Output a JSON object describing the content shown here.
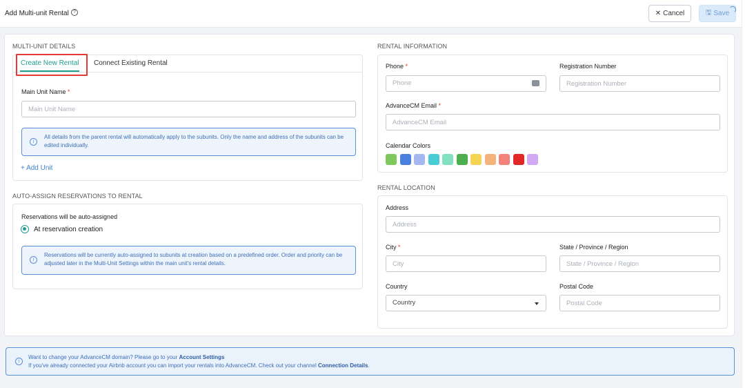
{
  "header": {
    "title": "Add Multi-unit Rental",
    "help_icon": "?",
    "cancel_label": "Cancel",
    "save_label": "Save"
  },
  "multi_unit": {
    "section_title": "MULTI-UNIT DETAILS",
    "tabs": [
      {
        "label": "Create New Rental",
        "active": true
      },
      {
        "label": "Connect Existing Rental",
        "active": false
      }
    ],
    "main_unit_label": "Main Unit Name",
    "main_unit_placeholder": "Main Unit Name",
    "info_text": "All details from the parent rental will automatically apply to the subunits. Only the name and address of the subunits can be edited individually.",
    "add_unit_label": "Add Unit"
  },
  "auto_assign": {
    "section_title": "AUTO-ASSIGN RESERVATIONS TO RENTAL",
    "label": "Reservations will be auto-assigned",
    "option_label": "At reservation creation",
    "info_text": "Reservations will be currently auto-assigned to subunits at creation based on a predefined order. Order and priority can be adjusted later in the Multi-Unit Settings within the main unit's rental details."
  },
  "rental_info": {
    "section_title": "RENTAL INFORMATION",
    "phone_label": "Phone",
    "phone_placeholder": "Phone",
    "registration_label": "Registration Number",
    "registration_placeholder": "Registration Number",
    "email_label": "AdvanceCM Email",
    "email_placeholder": "AdvanceCM Email",
    "calendar_colors_label": "Calendar Colors",
    "calendar_colors": [
      "#7dc95b",
      "#4a80e0",
      "#a5b8f0",
      "#46cdd6",
      "#83e1c1",
      "#4cae4c",
      "#f5d452",
      "#f6b27b",
      "#f3837a",
      "#e02828",
      "#d2a8f3"
    ]
  },
  "rental_location": {
    "section_title": "RENTAL LOCATION",
    "address_label": "Address",
    "address_placeholder": "Address",
    "city_label": "City",
    "city_placeholder": "City",
    "state_label": "State / Province / Region",
    "state_placeholder": "State / Province / Region",
    "country_label": "Country",
    "country_value": "Country",
    "postal_label": "Postal Code",
    "postal_placeholder": "Postal Code"
  },
  "footer": {
    "line1_text": "Want to change your AdvanceCM domain? Please go to your",
    "line1_link": "Account Settings",
    "line2_text": "If you've already connected your Airbnb account you can import your rentals into AdvanceCM. Check out your channel",
    "line2_link": "Connection Details",
    "line2_end": "."
  }
}
